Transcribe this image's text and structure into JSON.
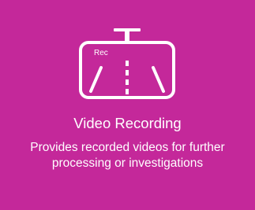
{
  "card": {
    "background_color": "#c4289a",
    "text_color": "#ffffff",
    "icon": {
      "name": "dashcam-icon",
      "screen_label": "Rec"
    },
    "title": "Video Recording",
    "description": "Provides recorded videos for further processing or investigations"
  }
}
